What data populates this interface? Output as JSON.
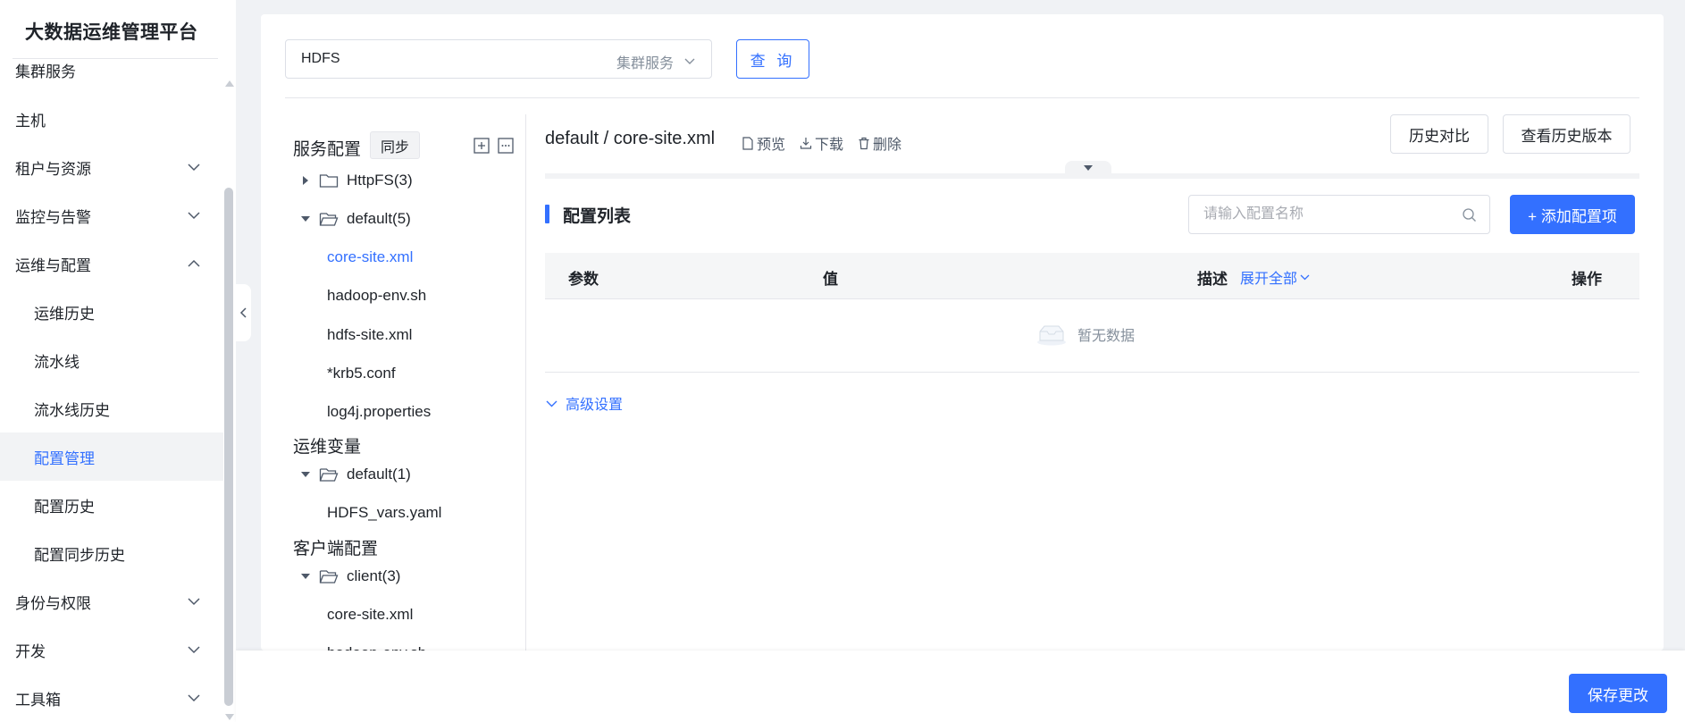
{
  "app": {
    "title": "大数据运维管理平台"
  },
  "sidebar": {
    "items": [
      {
        "label": "集群服务",
        "indent": false,
        "expandable": false
      },
      {
        "label": "主机",
        "indent": false,
        "expandable": false
      },
      {
        "label": "租户与资源",
        "indent": false,
        "expandable": true,
        "expanded": false
      },
      {
        "label": "监控与告警",
        "indent": false,
        "expandable": true,
        "expanded": false
      },
      {
        "label": "运维与配置",
        "indent": false,
        "expandable": true,
        "expanded": true
      },
      {
        "label": "运维历史",
        "indent": true
      },
      {
        "label": "流水线",
        "indent": true
      },
      {
        "label": "流水线历史",
        "indent": true
      },
      {
        "label": "配置管理",
        "indent": true,
        "active": true
      },
      {
        "label": "配置历史",
        "indent": true
      },
      {
        "label": "配置同步历史",
        "indent": true
      },
      {
        "label": "身份与权限",
        "indent": false,
        "expandable": true,
        "expanded": false
      },
      {
        "label": "开发",
        "indent": false,
        "expandable": true,
        "expanded": false
      },
      {
        "label": "工具箱",
        "indent": false,
        "expandable": true,
        "expanded": false
      }
    ]
  },
  "filter": {
    "service_value": "HDFS",
    "service_type": "集群服务",
    "query_label": "查 询"
  },
  "tree": {
    "service_config_label": "服务配置",
    "sync_label": "同步",
    "service_groups": [
      {
        "name": "HttpFS(3)",
        "expanded": false,
        "files": []
      },
      {
        "name": "default(5)",
        "expanded": true,
        "files": [
          "core-site.xml",
          "hadoop-env.sh",
          "hdfs-site.xml",
          "*krb5.conf",
          "log4j.properties"
        ]
      }
    ],
    "ops_vars_label": "运维变量",
    "ops_groups": [
      {
        "name": "default(1)",
        "expanded": true,
        "files": [
          "HDFS_vars.yaml"
        ]
      }
    ],
    "client_config_label": "客户端配置",
    "client_groups": [
      {
        "name": "client(3)",
        "expanded": true,
        "files": [
          "core-site.xml",
          "hadoop-env.sh"
        ]
      }
    ]
  },
  "content": {
    "path": "default / core-site.xml",
    "preview_label": "预览",
    "download_label": "下载",
    "delete_label": "删除",
    "history_compare_label": "历史对比",
    "view_history_label": "查看历史版本",
    "list_title": "配置列表",
    "search_placeholder": "请输入配置名称",
    "add_label": "+ 添加配置项",
    "table": {
      "col_param": "参数",
      "col_value": "值",
      "col_desc": "描述",
      "expand_all": "展开全部",
      "col_action": "操作",
      "empty_text": "暂无数据"
    },
    "advanced_label": "高级设置"
  },
  "footer": {
    "save_label": "保存更改"
  },
  "colors": {
    "accent": "#3370ff",
    "text": "#1f2329",
    "muted": "#86909c",
    "border": "#dcdfe6"
  }
}
